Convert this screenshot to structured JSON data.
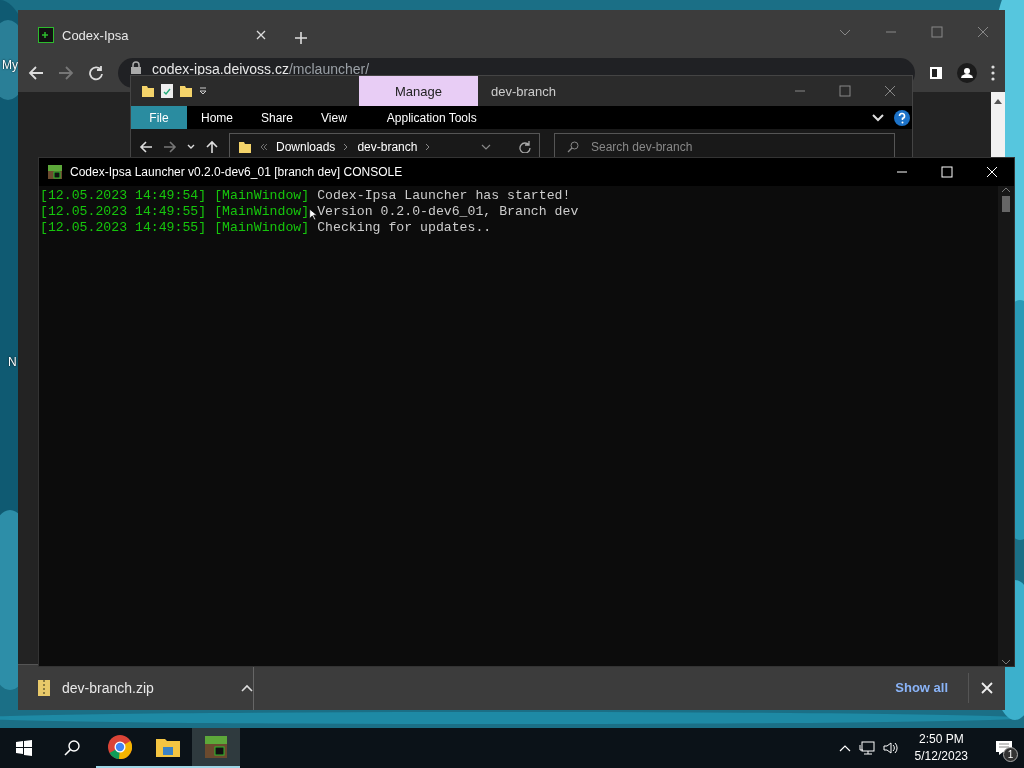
{
  "desktop": {
    "labels": [
      "My",
      "N"
    ]
  },
  "browser": {
    "tab": {
      "title": "Codex-Ipsa"
    },
    "address": {
      "host": "codex-ipsa.deivoss.cz",
      "path": "/mclauncher/"
    },
    "downloads": {
      "file": "dev-branch.zip",
      "show_all": "Show all"
    }
  },
  "explorer": {
    "title": "dev-branch",
    "contextual_tab": "Manage",
    "ribbon_tabs": [
      {
        "label": "File",
        "kind": "file"
      },
      {
        "label": "Home",
        "kind": "tab"
      },
      {
        "label": "Share",
        "kind": "tab"
      },
      {
        "label": "View",
        "kind": "tab"
      },
      {
        "label": "Application Tools",
        "kind": "contextual"
      }
    ],
    "breadcrumb": [
      "Downloads",
      "dev-branch"
    ],
    "search": {
      "placeholder": "Search dev-branch"
    }
  },
  "console": {
    "title": "Codex-Ipsa Launcher v0.2.0-dev6_01 [branch dev] CONSOLE",
    "lines": [
      {
        "timestamp": "[12.05.2023 14:49:54]",
        "source": "[MainWindow]",
        "message": "Codex-Ipsa Launcher has started!"
      },
      {
        "timestamp": "[12.05.2023 14:49:55]",
        "source": "[MainWindow]",
        "message": "Version 0.2.0-dev6_01, Branch dev"
      },
      {
        "timestamp": "[12.05.2023 14:49:55]",
        "source": "[MainWindow]",
        "message": "Checking for updates.."
      }
    ]
  },
  "taskbar": {
    "apps": [
      {
        "kind": "chrome",
        "running": true,
        "active": false
      },
      {
        "kind": "explorer",
        "running": true,
        "active": false
      },
      {
        "kind": "minecraft",
        "running": true,
        "active": true
      }
    ],
    "time": "2:50 PM",
    "date": "5/12/2023",
    "notifications": "1"
  }
}
